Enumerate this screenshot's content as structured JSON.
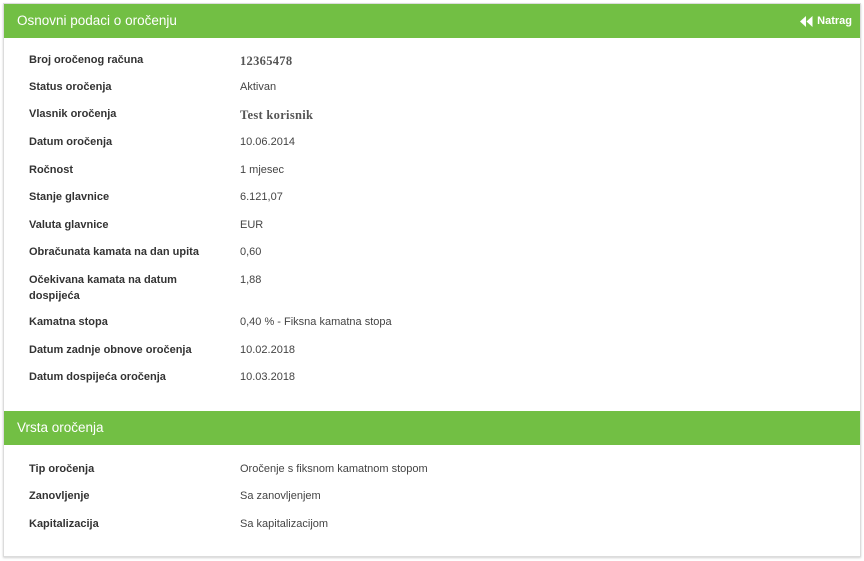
{
  "section1": {
    "title": "Osnovni podaci o oročenju",
    "back_label": "Natrag",
    "rows": [
      {
        "label": "Broj oročenog računa",
        "value": "12365478"
      },
      {
        "label": "Status oročenja",
        "value": "Aktivan"
      },
      {
        "label": "Vlasnik oročenja",
        "value": "Test korisnik"
      },
      {
        "label": "Datum oročenja",
        "value": "10.06.2014"
      },
      {
        "label": "Ročnost",
        "value": "1 mjesec"
      },
      {
        "label": "Stanje glavnice",
        "value": "6.121,07"
      },
      {
        "label": "Valuta glavnice",
        "value": "EUR"
      },
      {
        "label": "Obračunata kamata na dan upita",
        "value": "0,60"
      },
      {
        "label": "Očekivana kamata na datum dospijeća",
        "value": "1,88"
      },
      {
        "label": "Kamatna stopa",
        "value": "0,40 % - Fiksna kamatna stopa"
      },
      {
        "label": "Datum zadnje obnove oročenja",
        "value": "10.02.2018"
      },
      {
        "label": "Datum dospijeća oročenja",
        "value": "10.03.2018"
      }
    ]
  },
  "section2": {
    "title": "Vrsta oročenja",
    "rows": [
      {
        "label": "Tip oročenja",
        "value": "Oročenje s fiksnom kamatnom stopom"
      },
      {
        "label": "Zanovljenje",
        "value": "Sa zanovljenjem"
      },
      {
        "label": "Kapitalizacija",
        "value": "Sa kapitalizacijom"
      }
    ]
  },
  "colors": {
    "header_green": "#72bf44",
    "header_text": "#ffffff"
  },
  "icons": {
    "back": "double-chevron-left-icon"
  }
}
